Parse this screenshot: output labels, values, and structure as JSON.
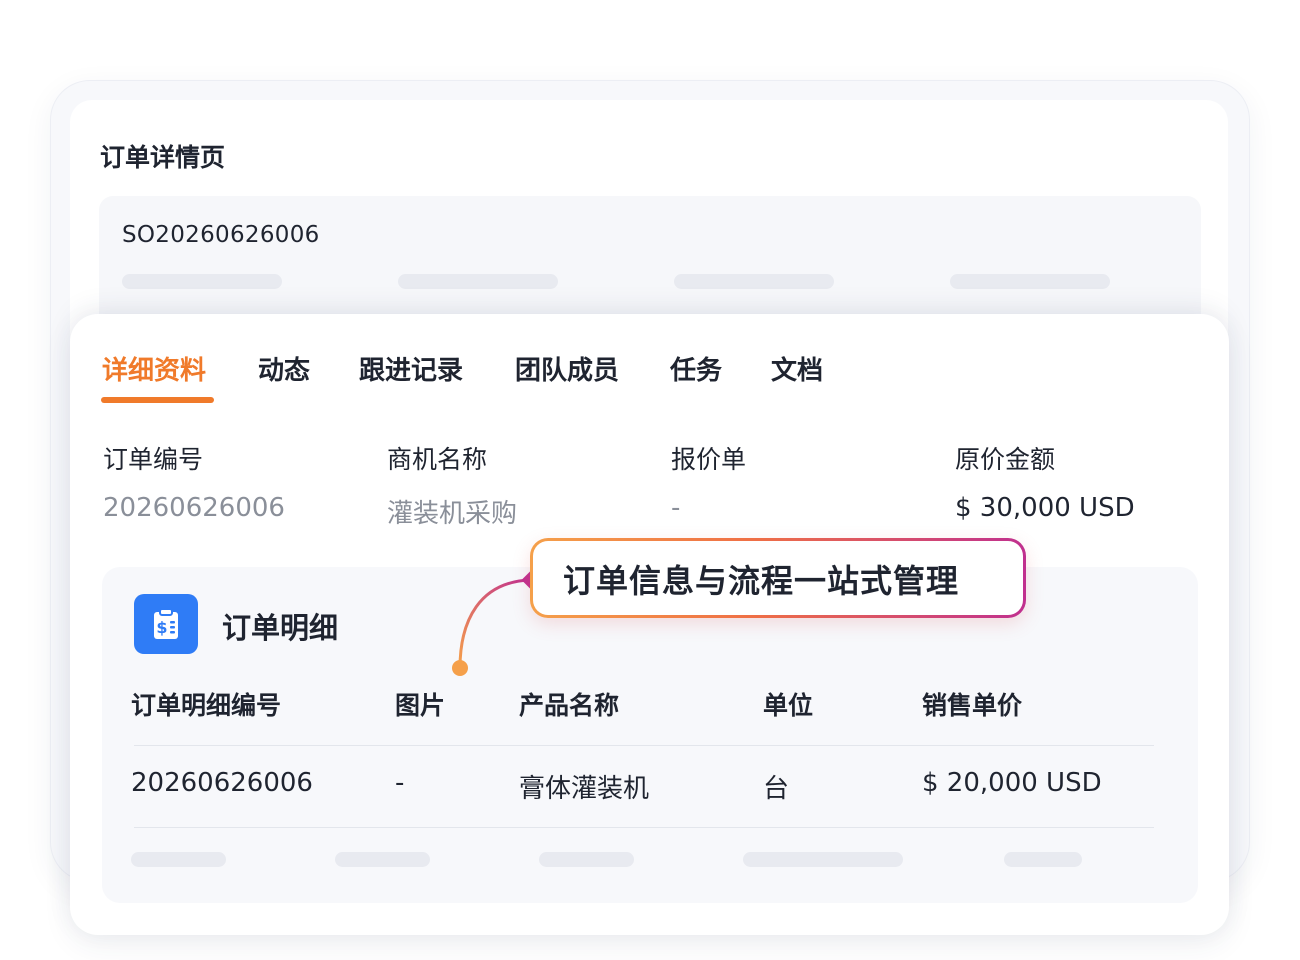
{
  "page": {
    "title": "订单详情页",
    "so_code": "SO20260626006"
  },
  "tabs": [
    {
      "label": "详细资料",
      "active": true
    },
    {
      "label": "动态",
      "active": false
    },
    {
      "label": "跟进记录",
      "active": false
    },
    {
      "label": "团队成员",
      "active": false
    },
    {
      "label": "任务",
      "active": false
    },
    {
      "label": "文档",
      "active": false
    }
  ],
  "fields": [
    {
      "label": "订单编号",
      "value": "20260626006"
    },
    {
      "label": "商机名称",
      "value": "灌装机采购"
    },
    {
      "label": "报价单",
      "value": "-"
    },
    {
      "label": "原价金额",
      "value": "$ 30,000 USD"
    }
  ],
  "detail": {
    "title": "订单明细",
    "icon": "clipboard-dollar-icon",
    "columns": [
      "订单明细编号",
      "图片",
      "产品名称",
      "单位",
      "销售单价"
    ],
    "rows": [
      [
        "20260626006",
        "-",
        "膏体灌装机",
        "台",
        "$ 20,000 USD"
      ]
    ]
  },
  "callout": {
    "text": "订单信息与流程一站式管理"
  },
  "colors": {
    "accent": "#f07a2a",
    "icon_bg": "#2f7cf6",
    "callout_gradient_start": "#f5a04a",
    "callout_gradient_end": "#c0308f"
  }
}
